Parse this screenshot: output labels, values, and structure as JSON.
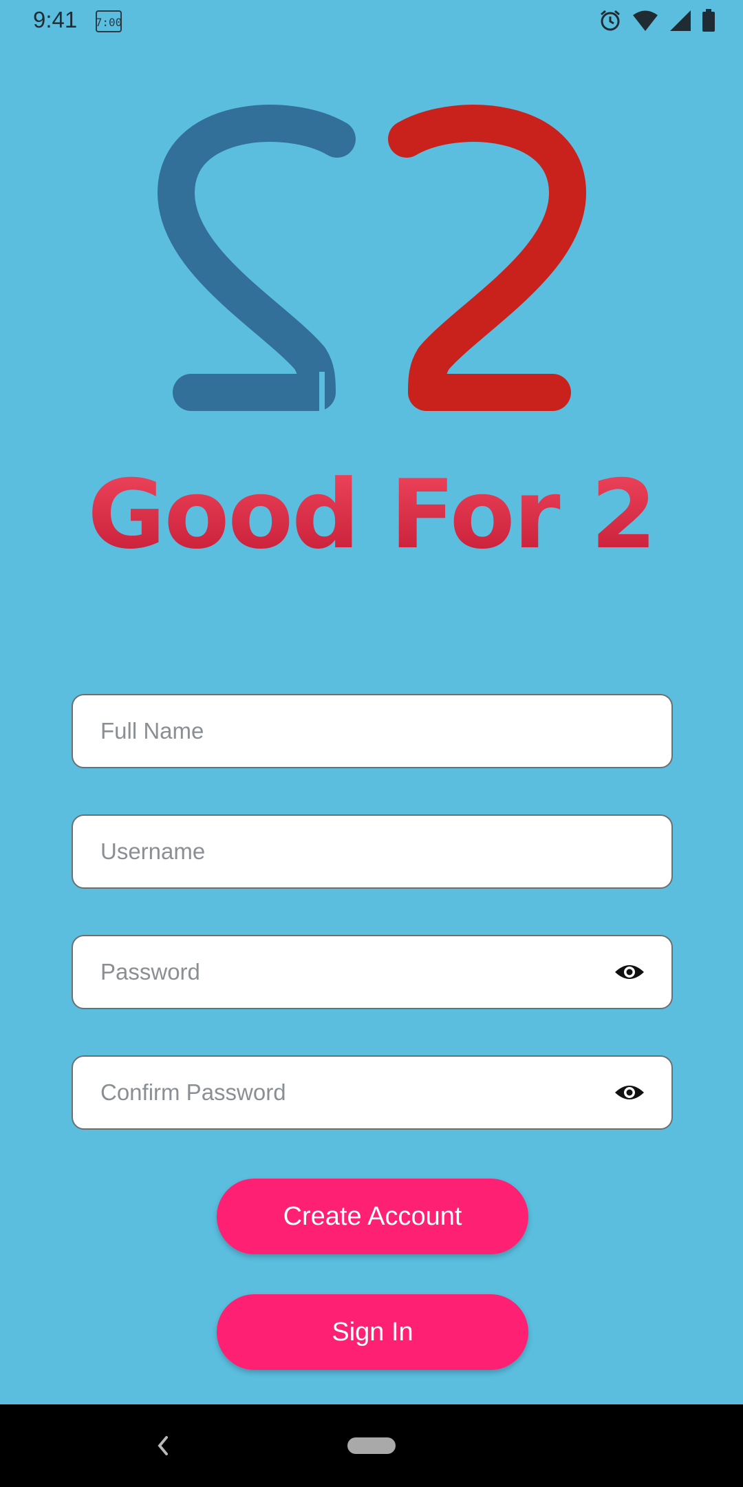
{
  "status_bar": {
    "time": "9:41",
    "icons": [
      "notification-icon",
      "alarm-icon",
      "wifi-icon",
      "signal-icon",
      "battery-icon"
    ]
  },
  "logo": {
    "title": "Good For 2",
    "colors": {
      "left": "#326f99",
      "right": "#c9221d",
      "title": "#d8203f"
    }
  },
  "form": {
    "full_name": {
      "placeholder": "Full Name",
      "value": ""
    },
    "username": {
      "placeholder": "Username",
      "value": ""
    },
    "password": {
      "placeholder": "Password",
      "value": ""
    },
    "confirm_password": {
      "placeholder": "Confirm Password",
      "value": ""
    }
  },
  "buttons": {
    "create_account": "Create Account",
    "sign_in": "Sign In"
  },
  "theme": {
    "background": "#5bbedf",
    "accent": "#fe2173"
  }
}
